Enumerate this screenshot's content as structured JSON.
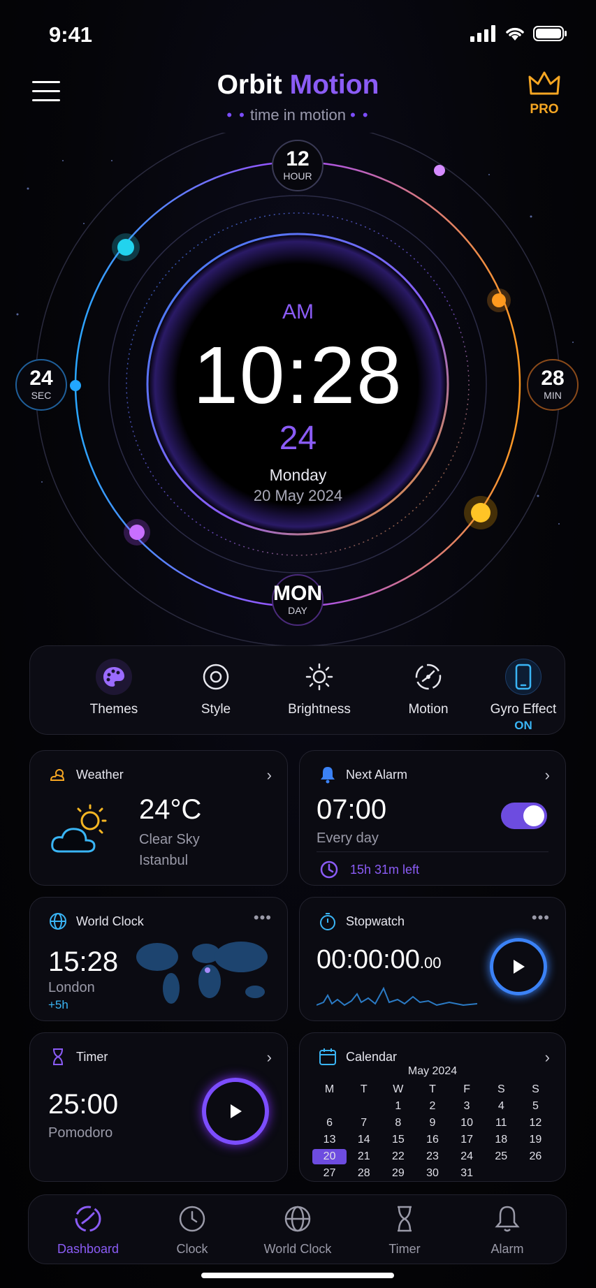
{
  "status": {
    "time": "9:41"
  },
  "header": {
    "title_main": "Orbit",
    "title_accent": "Motion",
    "subtitle": "time in motion",
    "pro_label": "PRO"
  },
  "clock": {
    "ampm": "AM",
    "time": "10:28",
    "seconds": "24",
    "day_name": "Monday",
    "date": "20 May 2024",
    "badges": {
      "hour": {
        "value": "12",
        "label": "HOUR"
      },
      "sec": {
        "value": "24",
        "label": "SEC"
      },
      "min": {
        "value": "28",
        "label": "MIN"
      },
      "day": {
        "value": "MON",
        "label": "DAY"
      }
    }
  },
  "quick_actions": [
    {
      "label": "Themes",
      "icon": "palette-icon"
    },
    {
      "label": "Style",
      "icon": "target-icon"
    },
    {
      "label": "Brightness",
      "icon": "sun-icon"
    },
    {
      "label": "Motion",
      "icon": "motion-icon"
    },
    {
      "label": "Gyro Effect",
      "icon": "phone-icon",
      "state": "ON"
    }
  ],
  "weather": {
    "title": "Weather",
    "temp": "24°C",
    "condition": "Clear Sky",
    "city": "Istanbul"
  },
  "alarm": {
    "title": "Next Alarm",
    "time": "07:00",
    "repeat": "Every day",
    "time_left": "15h 31m left",
    "enabled": true
  },
  "world_clock": {
    "title": "World Clock",
    "time": "15:28",
    "city": "London",
    "offset": "+5h"
  },
  "stopwatch": {
    "title": "Stopwatch",
    "time_main": "00:00:00",
    "time_ms": ".00"
  },
  "timer": {
    "title": "Timer",
    "time": "25:00",
    "mode": "Pomodoro"
  },
  "calendar": {
    "title": "Calendar",
    "month": "May 2024",
    "weekdays": [
      "M",
      "T",
      "W",
      "T",
      "F",
      "S",
      "S"
    ],
    "days": [
      "",
      "",
      "1",
      "2",
      "3",
      "4",
      "5",
      "6",
      "7",
      "8",
      "9",
      "10",
      "11",
      "12",
      "13",
      "14",
      "15",
      "16",
      "17",
      "18",
      "19",
      "20",
      "21",
      "22",
      "23",
      "24",
      "25",
      "26",
      "27",
      "28",
      "29",
      "30",
      "31"
    ],
    "selected": "20"
  },
  "nav": [
    {
      "label": "Dashboard",
      "icon": "dashboard-icon",
      "active": true
    },
    {
      "label": "Clock",
      "icon": "clock-icon"
    },
    {
      "label": "World Clock",
      "icon": "globe-icon"
    },
    {
      "label": "Timer",
      "icon": "hourglass-icon"
    },
    {
      "label": "Alarm",
      "icon": "bell-icon"
    }
  ],
  "colors": {
    "accent": "#8b5cf6",
    "blue": "#3ab5f5",
    "orange": "#f5a623",
    "card_bg": "#0b0b12"
  }
}
